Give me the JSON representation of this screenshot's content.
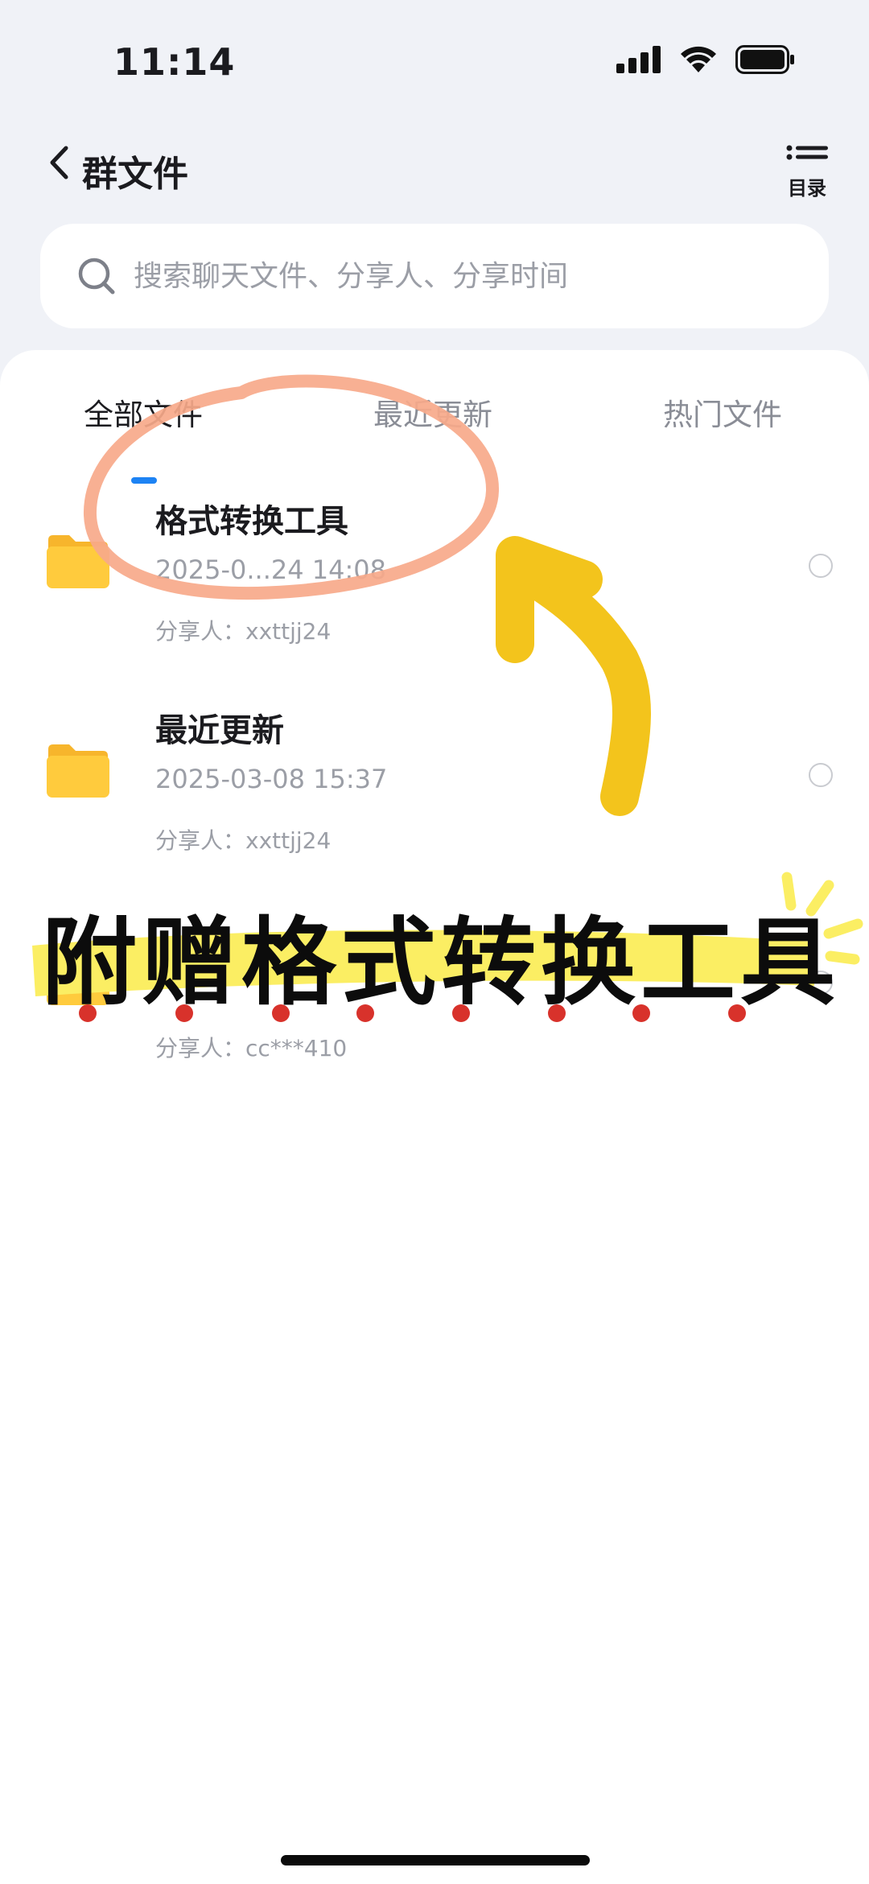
{
  "status_bar": {
    "time": "11:14"
  },
  "nav": {
    "title": "群文件",
    "toc_label": "目录"
  },
  "search": {
    "placeholder": "搜索聊天文件、分享人、分享时间"
  },
  "tabs": [
    {
      "label": "全部文件",
      "active": true
    },
    {
      "label": "最近更新",
      "active": false
    },
    {
      "label": "热门文件",
      "active": false
    }
  ],
  "files": [
    {
      "name": "格式转换工具",
      "date": "2025-0...24 14:08",
      "sharer": "分享人：xxttjj24"
    },
    {
      "name": "最近更新",
      "date": "2025-03-08 15:37",
      "sharer": "分享人：xxttjj24"
    },
    {
      "name": "",
      "date": "",
      "sharer": "分享人：cc***410"
    }
  ],
  "annotation": {
    "banner": "附赠格式转换工具"
  },
  "colors": {
    "accent": "#1d83f4",
    "folder": "#ffc83a",
    "circle_stroke": "#f7a98a",
    "arrow": "#f3c41c",
    "highlight": "#fbee63",
    "dots": "#d8322b"
  }
}
